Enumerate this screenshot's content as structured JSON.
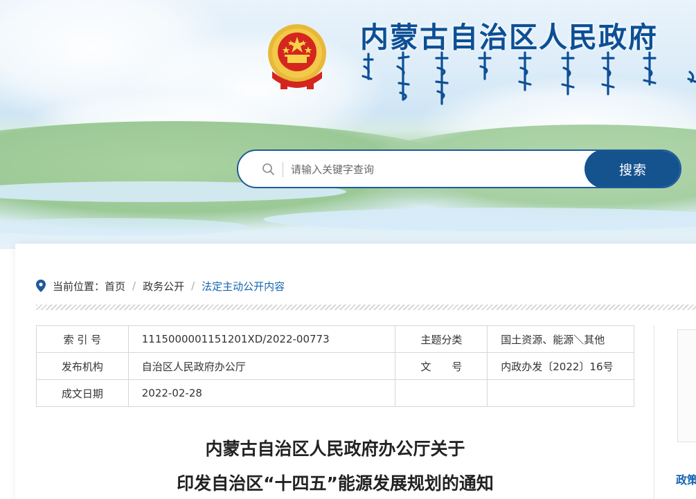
{
  "header": {
    "site_title": "内蒙古自治区人民政府",
    "emblem_icon": "national-emblem-icon",
    "mongolian_script_icon": "mongolian-script-title"
  },
  "search": {
    "placeholder": "请输入关键字查询",
    "button_label": "搜索",
    "icon": "search-icon"
  },
  "breadcrumb": {
    "prefix": "当前位置：",
    "items": [
      "首页",
      "政务公开",
      "法定主动公开内容"
    ],
    "separator": "/"
  },
  "meta": {
    "rows": [
      {
        "label1": "索 引 号",
        "value1": "1115000001151201XD/2022-00773",
        "label2": "主题分类",
        "value2": "国土资源、能源＼其他"
      },
      {
        "label1": "发布机构",
        "value1": "自治区人民政府办公厅",
        "label2": "文　　号",
        "value2": "内政办发〔2022〕16号"
      },
      {
        "label1": "成文日期",
        "value1": "2022-02-28",
        "label2": "",
        "value2": ""
      }
    ]
  },
  "document": {
    "title_line1": "内蒙古自治区人民政府办公厅关于",
    "title_line2": "印发自治区“十四五”能源发展规划的通知"
  },
  "sidebar": {
    "label": "政策"
  },
  "colors": {
    "brand_blue": "#0d4f95",
    "button_blue": "#15538f",
    "link_blue": "#1565b3"
  }
}
